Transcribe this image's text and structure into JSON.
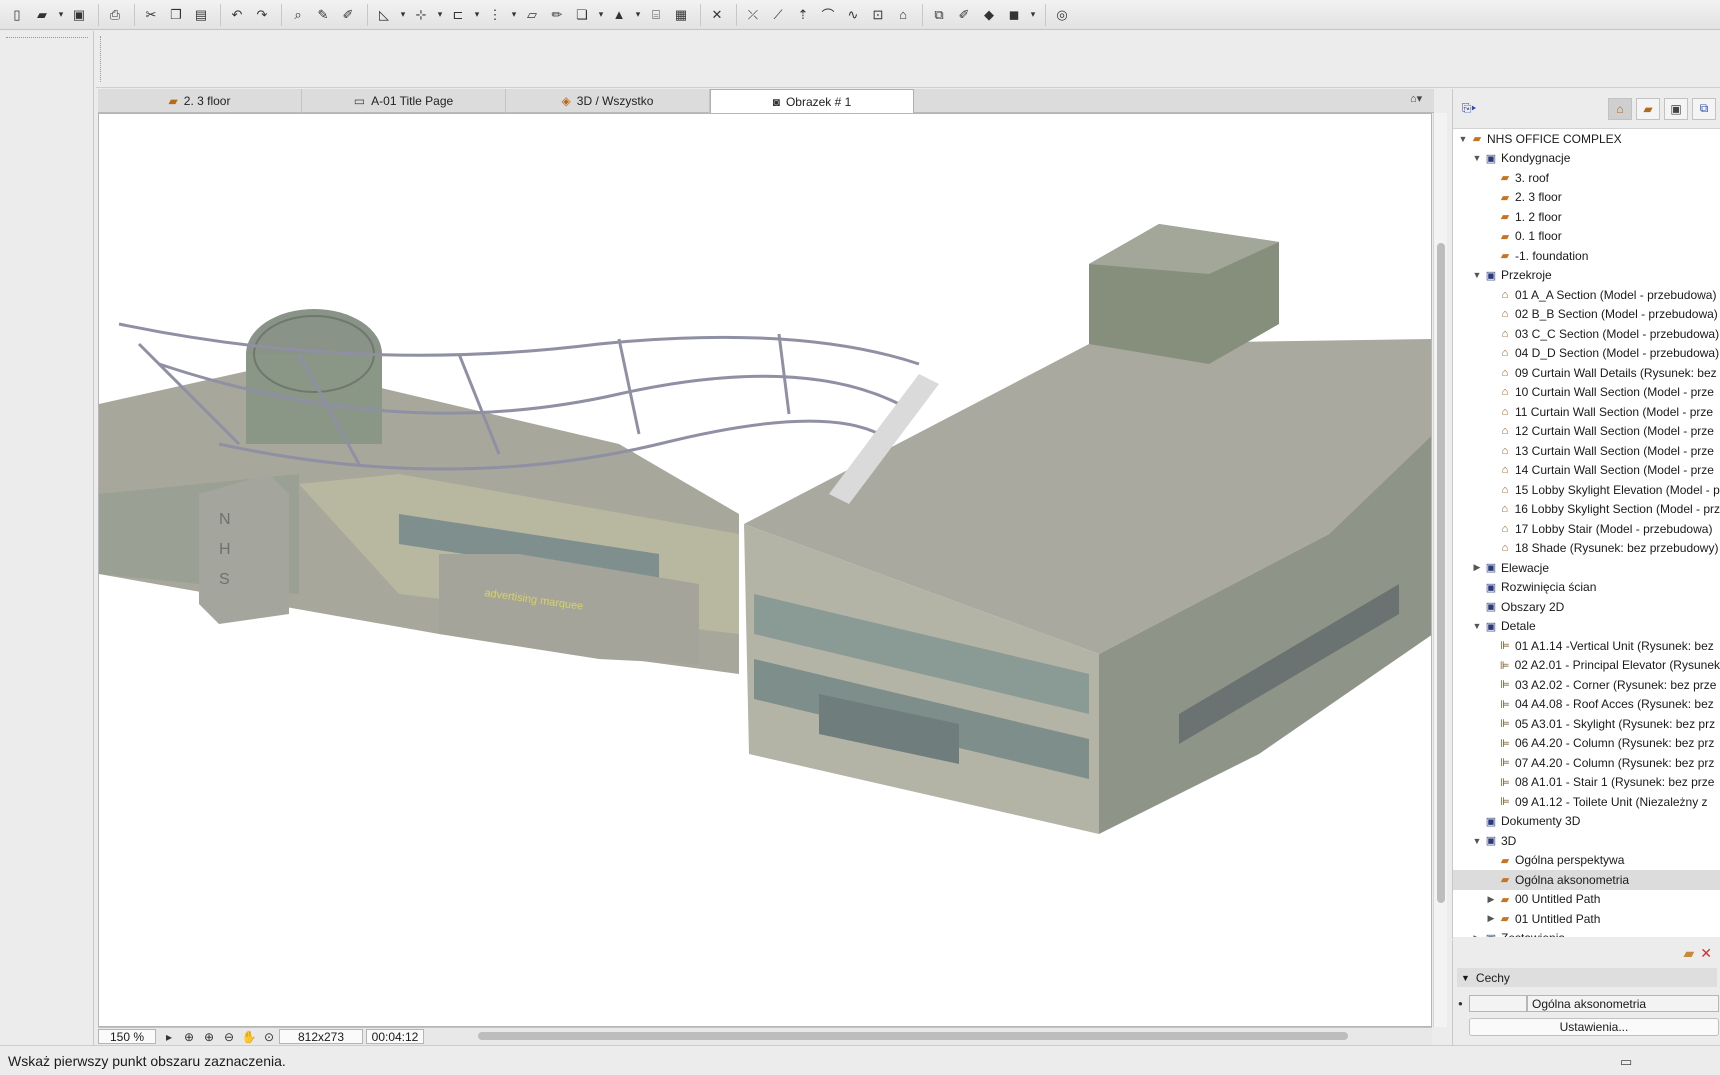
{
  "toolbar": {
    "icons": [
      "new-file-icon",
      "open-icon",
      "save-icon",
      "print-icon",
      "cut-icon",
      "copy-icon",
      "paste-icon",
      "undo-icon",
      "redo-icon",
      "find-icon",
      "eyedropper-icon",
      "syringe-icon",
      "snap-icon",
      "guide-icon",
      "offset-icon",
      "grid-icon",
      "plane-icon",
      "pencil-icon",
      "layers-icon",
      "lamp-icon",
      "stairs-icon",
      "table-icon",
      "close-x-icon",
      "trim-icon",
      "split-icon",
      "elevate-icon",
      "fillet-icon",
      "curve-icon",
      "adjust-icon",
      "house-icon",
      "group-icon",
      "brush-icon",
      "shade-icon",
      "render-icon",
      "globe-icon"
    ]
  },
  "tabs": [
    {
      "label": "2. 3 floor",
      "icon": "folder-icon",
      "active": false
    },
    {
      "label": "A-01 Title Page",
      "icon": "layout-icon",
      "active": false
    },
    {
      "label": "3D / Wszystko",
      "icon": "cube-icon",
      "active": false
    },
    {
      "label": "Obrazek # 1",
      "icon": "camera-icon",
      "active": true
    }
  ],
  "viewport": {
    "zoom": "150 %",
    "size": "812x273",
    "time": "00:04:12",
    "building_letters": [
      "N",
      "H",
      "S"
    ],
    "sign_text": "advertising marquee"
  },
  "status": {
    "message": "Wskaż pierwszy punkt obszaru zaznaczenia."
  },
  "navigator": {
    "rows": [
      {
        "label": "NHS OFFICE COMPLEX",
        "indent": 0,
        "tri": "open",
        "icon": "project-icon",
        "kind": "story"
      },
      {
        "label": "Kondygnacje",
        "indent": 1,
        "tri": "open",
        "icon": "stories-icon",
        "kind": "blue"
      },
      {
        "label": "3. roof",
        "indent": 2,
        "tri": "",
        "icon": "story-icon",
        "kind": "story"
      },
      {
        "label": "2. 3 floor",
        "indent": 2,
        "tri": "",
        "icon": "story-icon",
        "kind": "story"
      },
      {
        "label": "1. 2 floor",
        "indent": 2,
        "tri": "",
        "icon": "story-icon",
        "kind": "story"
      },
      {
        "label": "0. 1 floor",
        "indent": 2,
        "tri": "",
        "icon": "story-icon",
        "kind": "story"
      },
      {
        "label": "-1. foundation",
        "indent": 2,
        "tri": "",
        "icon": "story-icon",
        "kind": "story"
      },
      {
        "label": "Przekroje",
        "indent": 1,
        "tri": "open",
        "icon": "sections-icon",
        "kind": "blue"
      },
      {
        "label": "01 A_A Section (Model - przebudowa)",
        "indent": 2,
        "tri": "",
        "icon": "section-icon",
        "kind": "sec"
      },
      {
        "label": "02 B_B Section (Model - przebudowa)",
        "indent": 2,
        "tri": "",
        "icon": "section-icon",
        "kind": "sec"
      },
      {
        "label": "03 C_C Section (Model - przebudowa)",
        "indent": 2,
        "tri": "",
        "icon": "section-icon",
        "kind": "sec"
      },
      {
        "label": "04 D_D Section (Model - przebudowa)",
        "indent": 2,
        "tri": "",
        "icon": "section-icon",
        "kind": "sec"
      },
      {
        "label": "09 Curtain Wall Details (Rysunek: bez",
        "indent": 2,
        "tri": "",
        "icon": "section-icon",
        "kind": "sec"
      },
      {
        "label": "10 Curtain Wall Section (Model - prze",
        "indent": 2,
        "tri": "",
        "icon": "section-icon",
        "kind": "sec"
      },
      {
        "label": "11 Curtain Wall Section (Model - prze",
        "indent": 2,
        "tri": "",
        "icon": "section-icon",
        "kind": "sec"
      },
      {
        "label": "12 Curtain Wall Section (Model - prze",
        "indent": 2,
        "tri": "",
        "icon": "section-icon",
        "kind": "sec"
      },
      {
        "label": "13 Curtain Wall Section (Model - prze",
        "indent": 2,
        "tri": "",
        "icon": "section-icon",
        "kind": "sec"
      },
      {
        "label": "14 Curtain Wall Section (Model - prze",
        "indent": 2,
        "tri": "",
        "icon": "section-icon",
        "kind": "sec"
      },
      {
        "label": "15 Lobby Skylight Elevation (Model - p",
        "indent": 2,
        "tri": "",
        "icon": "section-icon",
        "kind": "sec"
      },
      {
        "label": "16 Lobby Skylight Section (Model - prz",
        "indent": 2,
        "tri": "",
        "icon": "section-icon",
        "kind": "sec"
      },
      {
        "label": "17 Lobby Stair (Model - przebudowa)",
        "indent": 2,
        "tri": "",
        "icon": "section-icon",
        "kind": "sec"
      },
      {
        "label": "18 Shade (Rysunek: bez przebudowy)",
        "indent": 2,
        "tri": "",
        "icon": "section-icon",
        "kind": "sec"
      },
      {
        "label": "Elewacje",
        "indent": 1,
        "tri": "closed",
        "icon": "elevations-icon",
        "kind": "blue"
      },
      {
        "label": "Rozwinięcia ścian",
        "indent": 1,
        "tri": "",
        "icon": "interior-elevations-icon",
        "kind": "blue"
      },
      {
        "label": "Obszary 2D",
        "indent": 1,
        "tri": "",
        "icon": "worksheet-icon",
        "kind": "blue"
      },
      {
        "label": "Detale",
        "indent": 1,
        "tri": "open",
        "icon": "details-icon",
        "kind": "blue"
      },
      {
        "label": "01 A1.14 -Vertical Unit (Rysunek: bez",
        "indent": 2,
        "tri": "",
        "icon": "detail-icon",
        "kind": "det"
      },
      {
        "label": "02 A2.01 - Principal Elevator (Rysunek",
        "indent": 2,
        "tri": "",
        "icon": "detail-icon",
        "kind": "det"
      },
      {
        "label": "03 A2.02 - Corner (Rysunek: bez prze",
        "indent": 2,
        "tri": "",
        "icon": "detail-icon",
        "kind": "det"
      },
      {
        "label": "04 A4.08 - Roof Acces (Rysunek: bez",
        "indent": 2,
        "tri": "",
        "icon": "detail-icon",
        "kind": "det"
      },
      {
        "label": "05 A3.01 - Skylight (Rysunek: bez prz",
        "indent": 2,
        "tri": "",
        "icon": "detail-icon",
        "kind": "det"
      },
      {
        "label": "06 A4.20 - Column (Rysunek: bez prz",
        "indent": 2,
        "tri": "",
        "icon": "detail-icon",
        "kind": "det"
      },
      {
        "label": "07 A4.20 - Column (Rysunek: bez prz",
        "indent": 2,
        "tri": "",
        "icon": "detail-icon",
        "kind": "det"
      },
      {
        "label": "08 A1.01 - Stair 1 (Rysunek: bez prze",
        "indent": 2,
        "tri": "",
        "icon": "detail-icon",
        "kind": "det"
      },
      {
        "label": "09 A1.12 - Toilete Unit (Niezależny z",
        "indent": 2,
        "tri": "",
        "icon": "detail-icon",
        "kind": "det"
      },
      {
        "label": "Dokumenty 3D",
        "indent": 1,
        "tri": "",
        "icon": "3d-documents-icon",
        "kind": "blue"
      },
      {
        "label": "3D",
        "indent": 1,
        "tri": "open",
        "icon": "3d-icon",
        "kind": "blue"
      },
      {
        "label": "Ogólna perspektywa",
        "indent": 2,
        "tri": "",
        "icon": "perspective-icon",
        "kind": "story"
      },
      {
        "label": "Ogólna aksonometria",
        "indent": 2,
        "tri": "",
        "icon": "axonometry-icon",
        "kind": "story",
        "selected": true
      },
      {
        "label": "00 Untitled Path",
        "indent": 2,
        "tri": "closed",
        "icon": "path-icon",
        "kind": "story"
      },
      {
        "label": "01 Untitled Path",
        "indent": 2,
        "tri": "closed",
        "icon": "path-icon",
        "kind": "story"
      },
      {
        "label": "Zestawienia",
        "indent": 1,
        "tri": "closed",
        "icon": "schedules-icon",
        "kind": "blue"
      }
    ]
  },
  "properties": {
    "header": "Cechy",
    "name_value": "Ogólna aksonometria",
    "settings_button": "Ustawienia..."
  }
}
